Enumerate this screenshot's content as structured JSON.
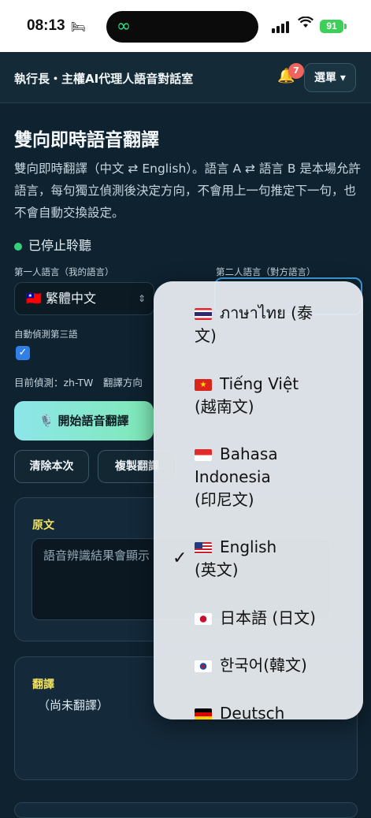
{
  "status_bar": {
    "time": "08:13",
    "battery": "91"
  },
  "header": {
    "title": "執行長・主權AI代理人語音對話室",
    "notification_count": "7",
    "menu_label": "選單 ▾"
  },
  "main": {
    "title": "雙向即時語音翻譯",
    "description": "雙向即時翻譯（中文 ⇄ English）。語言 A ⇄ 語言 B 是本場允許語言，每句獨立偵測後決定方向，不會用上一句推定下一句，也不會自動交換設定。",
    "status": "已停止聆聽",
    "status_color": "#34d07a",
    "lang1_label": "第一人語言（我的語言）",
    "lang2_label": "第二人語言（對方語言）",
    "lang1_value": "🇹🇼 繁體中文",
    "auto_detect_label": "自動偵測第三語",
    "auto_detect_checked": true,
    "detect_info": "目前偵測：zh-TW　翻譯方向",
    "start_button": "🎙️ 開始語音翻譯",
    "clear_button": "清除本次",
    "copy_button": "複製翻譯",
    "source_card_title": "原文",
    "source_placeholder": "語音辨識結果會顯示",
    "translation_card_title": "翻譯",
    "translation_text": "（尚未翻譯）"
  },
  "dropdown": {
    "selected": "English（英文）",
    "options": [
      {
        "flag": "thailand-flag",
        "line1": "ภาษาไทย (泰",
        "line2": "文)"
      },
      {
        "flag": "vietnam-flag",
        "line1": "Tiếng Việt",
        "line2": "(越南文)"
      },
      {
        "flag": "indonesia-flag",
        "line1": "Bahasa",
        "line2": "Indonesia",
        "line3": "(印尼文)"
      },
      {
        "flag": "usa-flag",
        "line1": "English",
        "line2": "(英文)"
      },
      {
        "flag": "japan-flag",
        "line1": "日本語 (日文)"
      },
      {
        "flag": "korea-flag",
        "line1": "한국어(韓文)"
      },
      {
        "flag": "germany-flag",
        "line1": "Deutsch"
      }
    ]
  },
  "colors": {
    "accent": "#3e9fdc",
    "background": "#0f2230",
    "card_title": "#f3e45e"
  }
}
